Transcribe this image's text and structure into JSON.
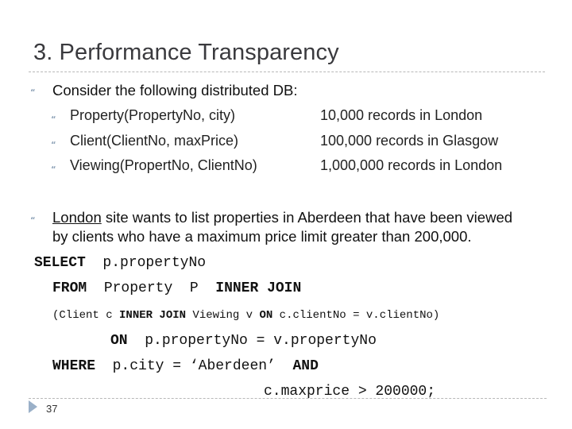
{
  "slide": {
    "title": "3. Performance Transparency",
    "bullet_icon": "wingdings-bullet-icon",
    "bullets": [
      {
        "text": "Consider the following distributed DB:",
        "sub": [
          {
            "relation": "Property(PropertyNo, city)",
            "info": "10,000 records in London"
          },
          {
            "relation": "Client(ClientNo, maxPrice)",
            "info": "100,000 records in Glasgow"
          },
          {
            "relation": "Viewing(PropertNo, ClientNo)",
            "info": "1,000,000 records in London"
          }
        ]
      },
      {
        "underlined": "London",
        "line1_rest": " site wants to list properties in Aberdeen that have been viewed",
        "line2": "by clients who have a maximum price limit greater than 200,000."
      }
    ],
    "sql": {
      "select_kw": "SELECT",
      "select_expr": "p.propertyNo",
      "from_kw": "FROM",
      "from_table": "Property  P",
      "inner_join_kw": "INNER JOIN",
      "sub_open": "(Client c ",
      "sub_inner_join_kw": "INNER JOIN",
      "sub_mid": " Viewing v ",
      "sub_on_kw": "ON",
      "sub_cond": " c.clientNo = v.clientNo)",
      "on_kw": "ON",
      "on_cond": "p.propertyNo = v.propertyNo",
      "where_kw": "WHERE",
      "where_cond": "p.city = ‘Aberdeen’",
      "and_kw": "AND",
      "last_cond": "c.maxprice > 200000;"
    },
    "page_number": "37",
    "colors": {
      "title": "#3a3a3e",
      "bullet": "#8fa3b8",
      "rule": "#b8b8b8",
      "page_arrow": "#9ab0c8"
    }
  }
}
